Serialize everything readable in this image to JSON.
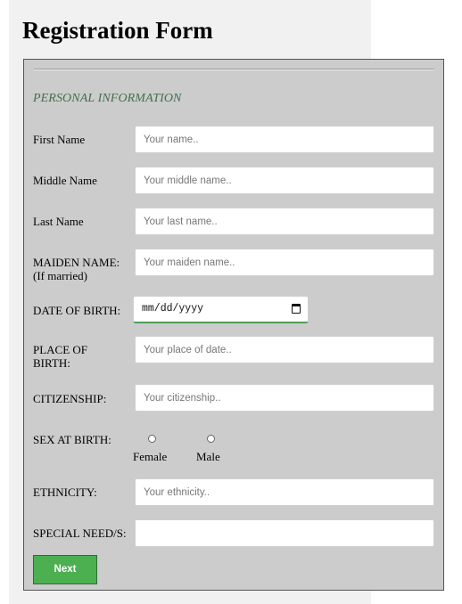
{
  "title": "Registration Form",
  "section": "PERSONAL INFORMATION",
  "fields": {
    "first_name": {
      "label": "First Name",
      "placeholder": "Your name.."
    },
    "middle_name": {
      "label": "Middle Name",
      "placeholder": "Your middle name.."
    },
    "last_name": {
      "label": "Last Name",
      "placeholder": "Your last name.."
    },
    "maiden_name": {
      "label": "MAIDEN NAME:",
      "label_note": "(If married)",
      "placeholder": "Your maiden name.."
    },
    "dob": {
      "label": "DATE OF BIRTH:",
      "placeholder": "mm/dd/yyyy"
    },
    "place_of_birth": {
      "label_line1": "PLACE OF",
      "label_line2": "BIRTH:",
      "placeholder": "Your place of date.."
    },
    "citizenship": {
      "label": "CITIZENSHIP:",
      "placeholder": "Your citizenship.."
    },
    "sex_at_birth": {
      "label": "SEX AT BIRTH:",
      "options": [
        "Female",
        "Male"
      ]
    },
    "ethnicity": {
      "label": "ETHNICITY:",
      "placeholder": "Your ethnicity.."
    },
    "special_needs": {
      "label": "SPECIAL NEED/S:",
      "placeholder": ""
    }
  },
  "next_button": "Next",
  "colors": {
    "accent": "#4caf50",
    "section_text": "#41704a",
    "form_bg": "#cccccc"
  },
  "icons": {
    "date_picker": "calendar-icon"
  }
}
